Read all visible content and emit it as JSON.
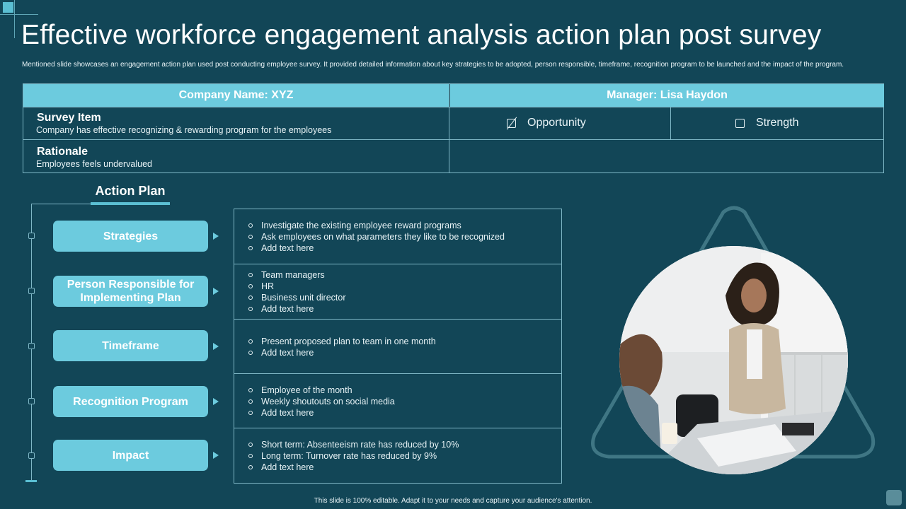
{
  "slide": {
    "title": "Effective workforce engagement analysis action plan post survey",
    "subtitle": "Mentioned slide showcases an engagement action plan used post conducting employee survey. It provided detailed information about key strategies to be adopted, person responsible, timeframe, recognition program to be launched and the impact of the program.",
    "footer": "This slide is 100% editable. Adapt it to your needs and capture your audience's attention."
  },
  "top_table": {
    "company_header": "Company Name: XYZ",
    "manager_header": "Manager:  Lisa Haydon",
    "survey_item_title": "Survey Item",
    "survey_item_text": "Company has effective  recognizing  & rewarding  program  for the employees",
    "rationale_title": "Rationale",
    "rationale_text": "Employees feels undervalued",
    "options": [
      {
        "label": "Opportunity",
        "checked": true,
        "icon": "checked-box-icon"
      },
      {
        "label": "Strength",
        "checked": false,
        "icon": "empty-checkbox-icon"
      }
    ]
  },
  "action_plan": {
    "heading": "Action Plan",
    "rows": [
      {
        "label": "Strategies",
        "items": [
          "Investigate  the existing employee reward  programs",
          "Ask employees  on what  parameters they like to be recognized",
          "Add text here"
        ]
      },
      {
        "label": "Person Responsible for Implementing Plan",
        "items": [
          "Team  managers",
          "HR",
          "Business unit director",
          "Add text here"
        ]
      },
      {
        "label": "Timeframe",
        "items": [
          "Present  proposed  plan to team in one month",
          "Add text here"
        ]
      },
      {
        "label": "Recognition Program",
        "items": [
          "Employee  of the month",
          "Weekly shoutouts on social media",
          "Add text here"
        ]
      },
      {
        "label": "Impact",
        "items": [
          "Short term: Absenteeism rate has reduced  by 10%",
          "Long term: Turnover  rate has reduced  by 9%",
          "Add text here"
        ]
      }
    ]
  },
  "colors": {
    "background": "#124657",
    "accent": "#6ccbde",
    "line": "#7fb7c6"
  }
}
